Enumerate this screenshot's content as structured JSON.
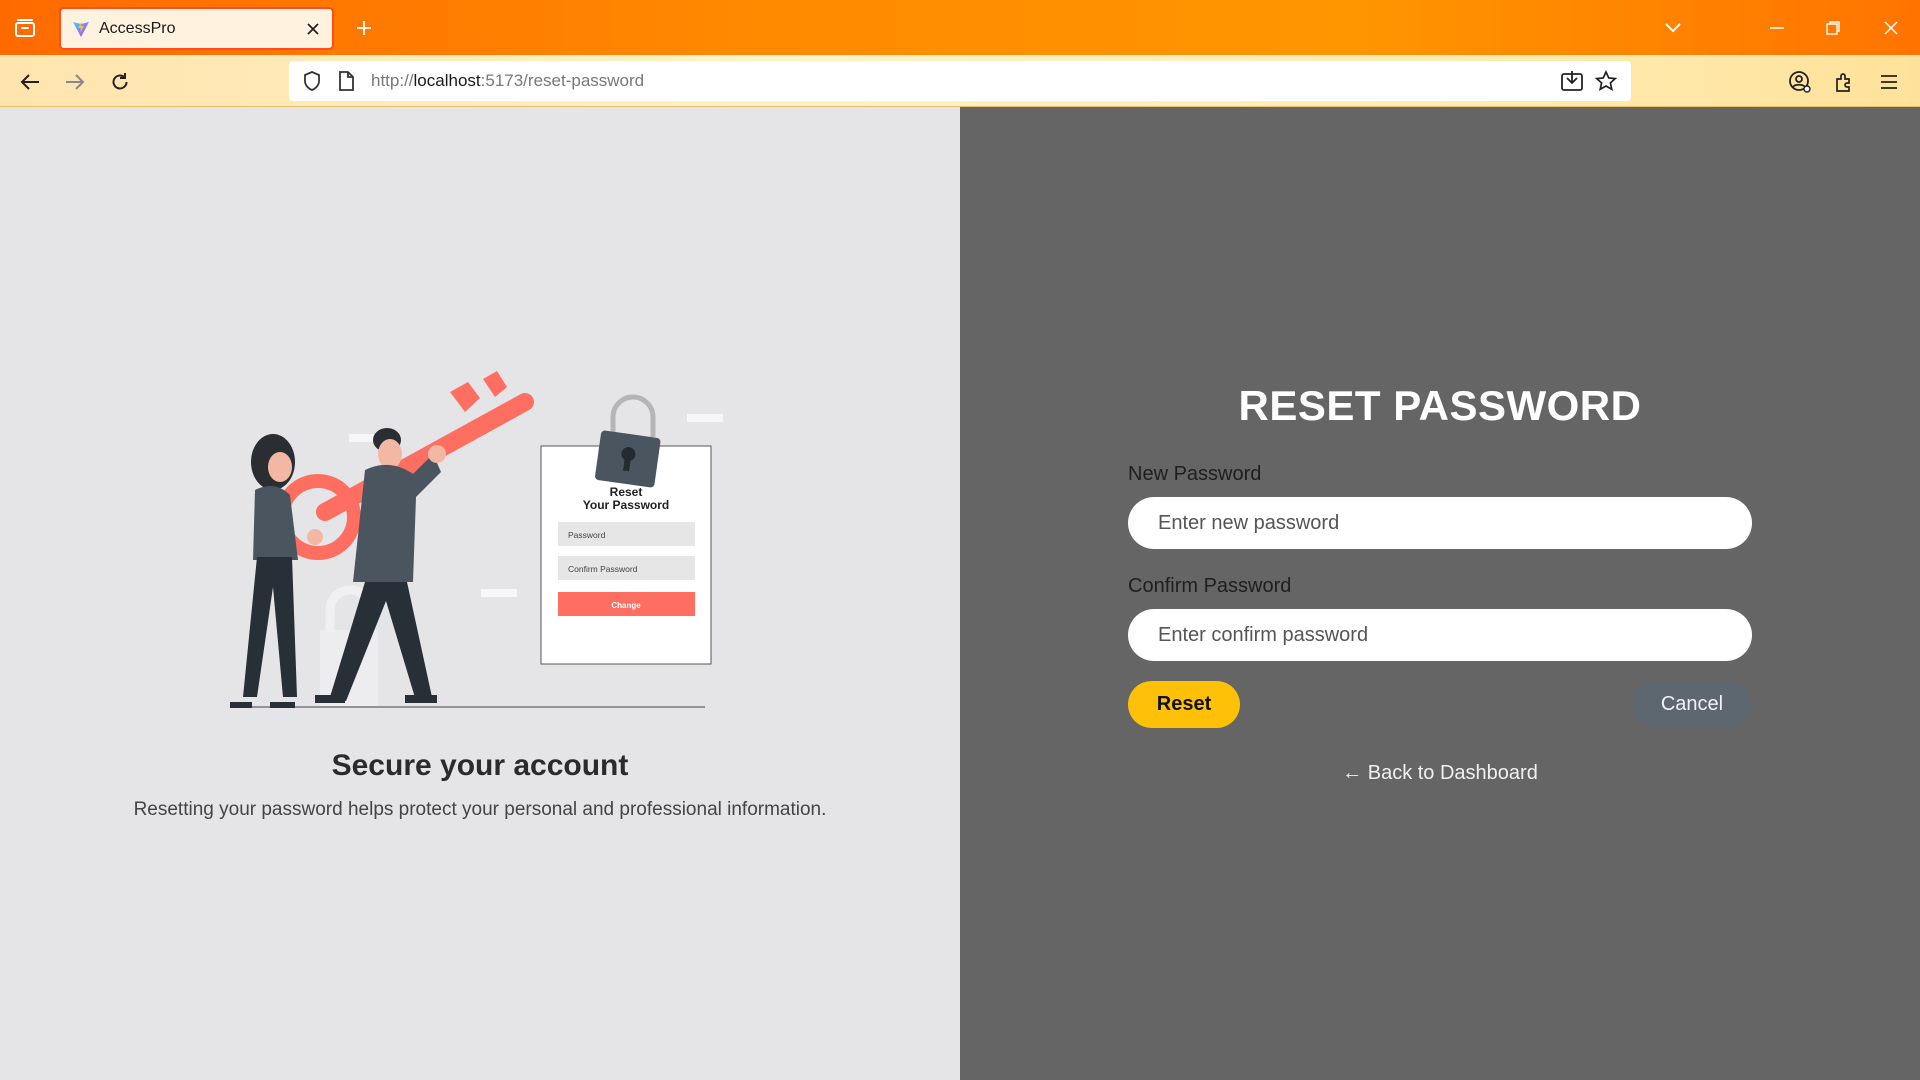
{
  "browser": {
    "tab_title": "AccessPro",
    "url_scheme": "http://",
    "url_host": "localhost",
    "url_path": ":5173/reset-password",
    "accent_color": "#ff8a00"
  },
  "illustration": {
    "card_title": "Reset",
    "card_title_line2": "Your Password",
    "card_field1": "Password",
    "card_field2": "Confirm Password",
    "card_button": "Change",
    "accent_color": "#ff6f61"
  },
  "left_panel": {
    "heading": "Secure your account",
    "subtext": "Resetting your password helps protect your personal and professional information."
  },
  "form": {
    "title": "RESET PASSWORD",
    "new_password_label": "New Password",
    "new_password_placeholder": "Enter new password",
    "confirm_password_label": "Confirm Password",
    "confirm_password_placeholder": "Enter confirm password",
    "reset_label": "Reset",
    "cancel_label": "Cancel",
    "back_link": "← Back to Dashboard",
    "reset_color": "#ffc107",
    "cancel_color": "#5c6770"
  }
}
